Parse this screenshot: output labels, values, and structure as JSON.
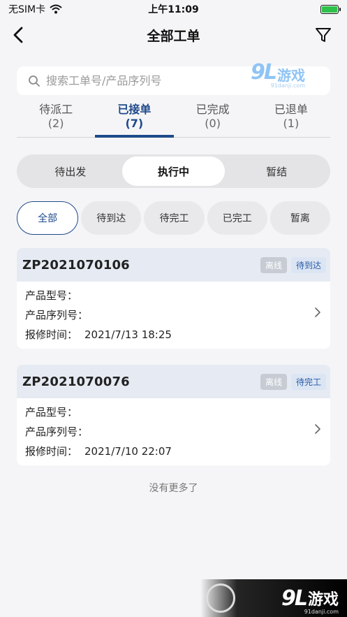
{
  "status_bar": {
    "carrier": "无SIM卡",
    "time": "上午11:09"
  },
  "nav": {
    "title": "全部工单",
    "back_icon": "chevron-left-icon",
    "filter_icon": "filter-icon"
  },
  "search": {
    "placeholder": "搜索工单号/产品序列号",
    "value": ""
  },
  "tabs": [
    {
      "label": "待派工",
      "count": "(2)"
    },
    {
      "label": "已接单",
      "count": "(7)",
      "active": true
    },
    {
      "label": "已完成",
      "count": "(0)"
    },
    {
      "label": "已退单",
      "count": "(1)"
    }
  ],
  "segments": [
    {
      "label": "待出发"
    },
    {
      "label": "执行中",
      "active": true
    },
    {
      "label": "暂结"
    }
  ],
  "chips": [
    {
      "label": "全部",
      "active": true
    },
    {
      "label": "待到达"
    },
    {
      "label": "待完工"
    },
    {
      "label": "已完工"
    },
    {
      "label": "暂离"
    }
  ],
  "orders": [
    {
      "order_no": "ZP2021070106",
      "offline_badge": "离线",
      "status_badge": "待到达",
      "model_label": "产品型号：",
      "model_value": "",
      "serial_label": "产品序列号：",
      "serial_value": "",
      "time_label": "报修时间：",
      "time_value": "2021/7/13 18:25"
    },
    {
      "order_no": "ZP2021070076",
      "offline_badge": "离线",
      "status_badge": "待完工",
      "model_label": "产品型号：",
      "model_value": "",
      "serial_label": "产品序列号：",
      "serial_value": "",
      "time_label": "报修时间：",
      "time_value": "2021/7/10 22:07"
    }
  ],
  "footer": {
    "no_more": "没有更多了"
  },
  "watermark": {
    "brand_num": "9L",
    "brand_text": "游戏",
    "url": "91danji.com"
  },
  "colors": {
    "accent": "#1e4a8c",
    "background": "#f5f5f7",
    "card_header": "#e6ebf3"
  }
}
